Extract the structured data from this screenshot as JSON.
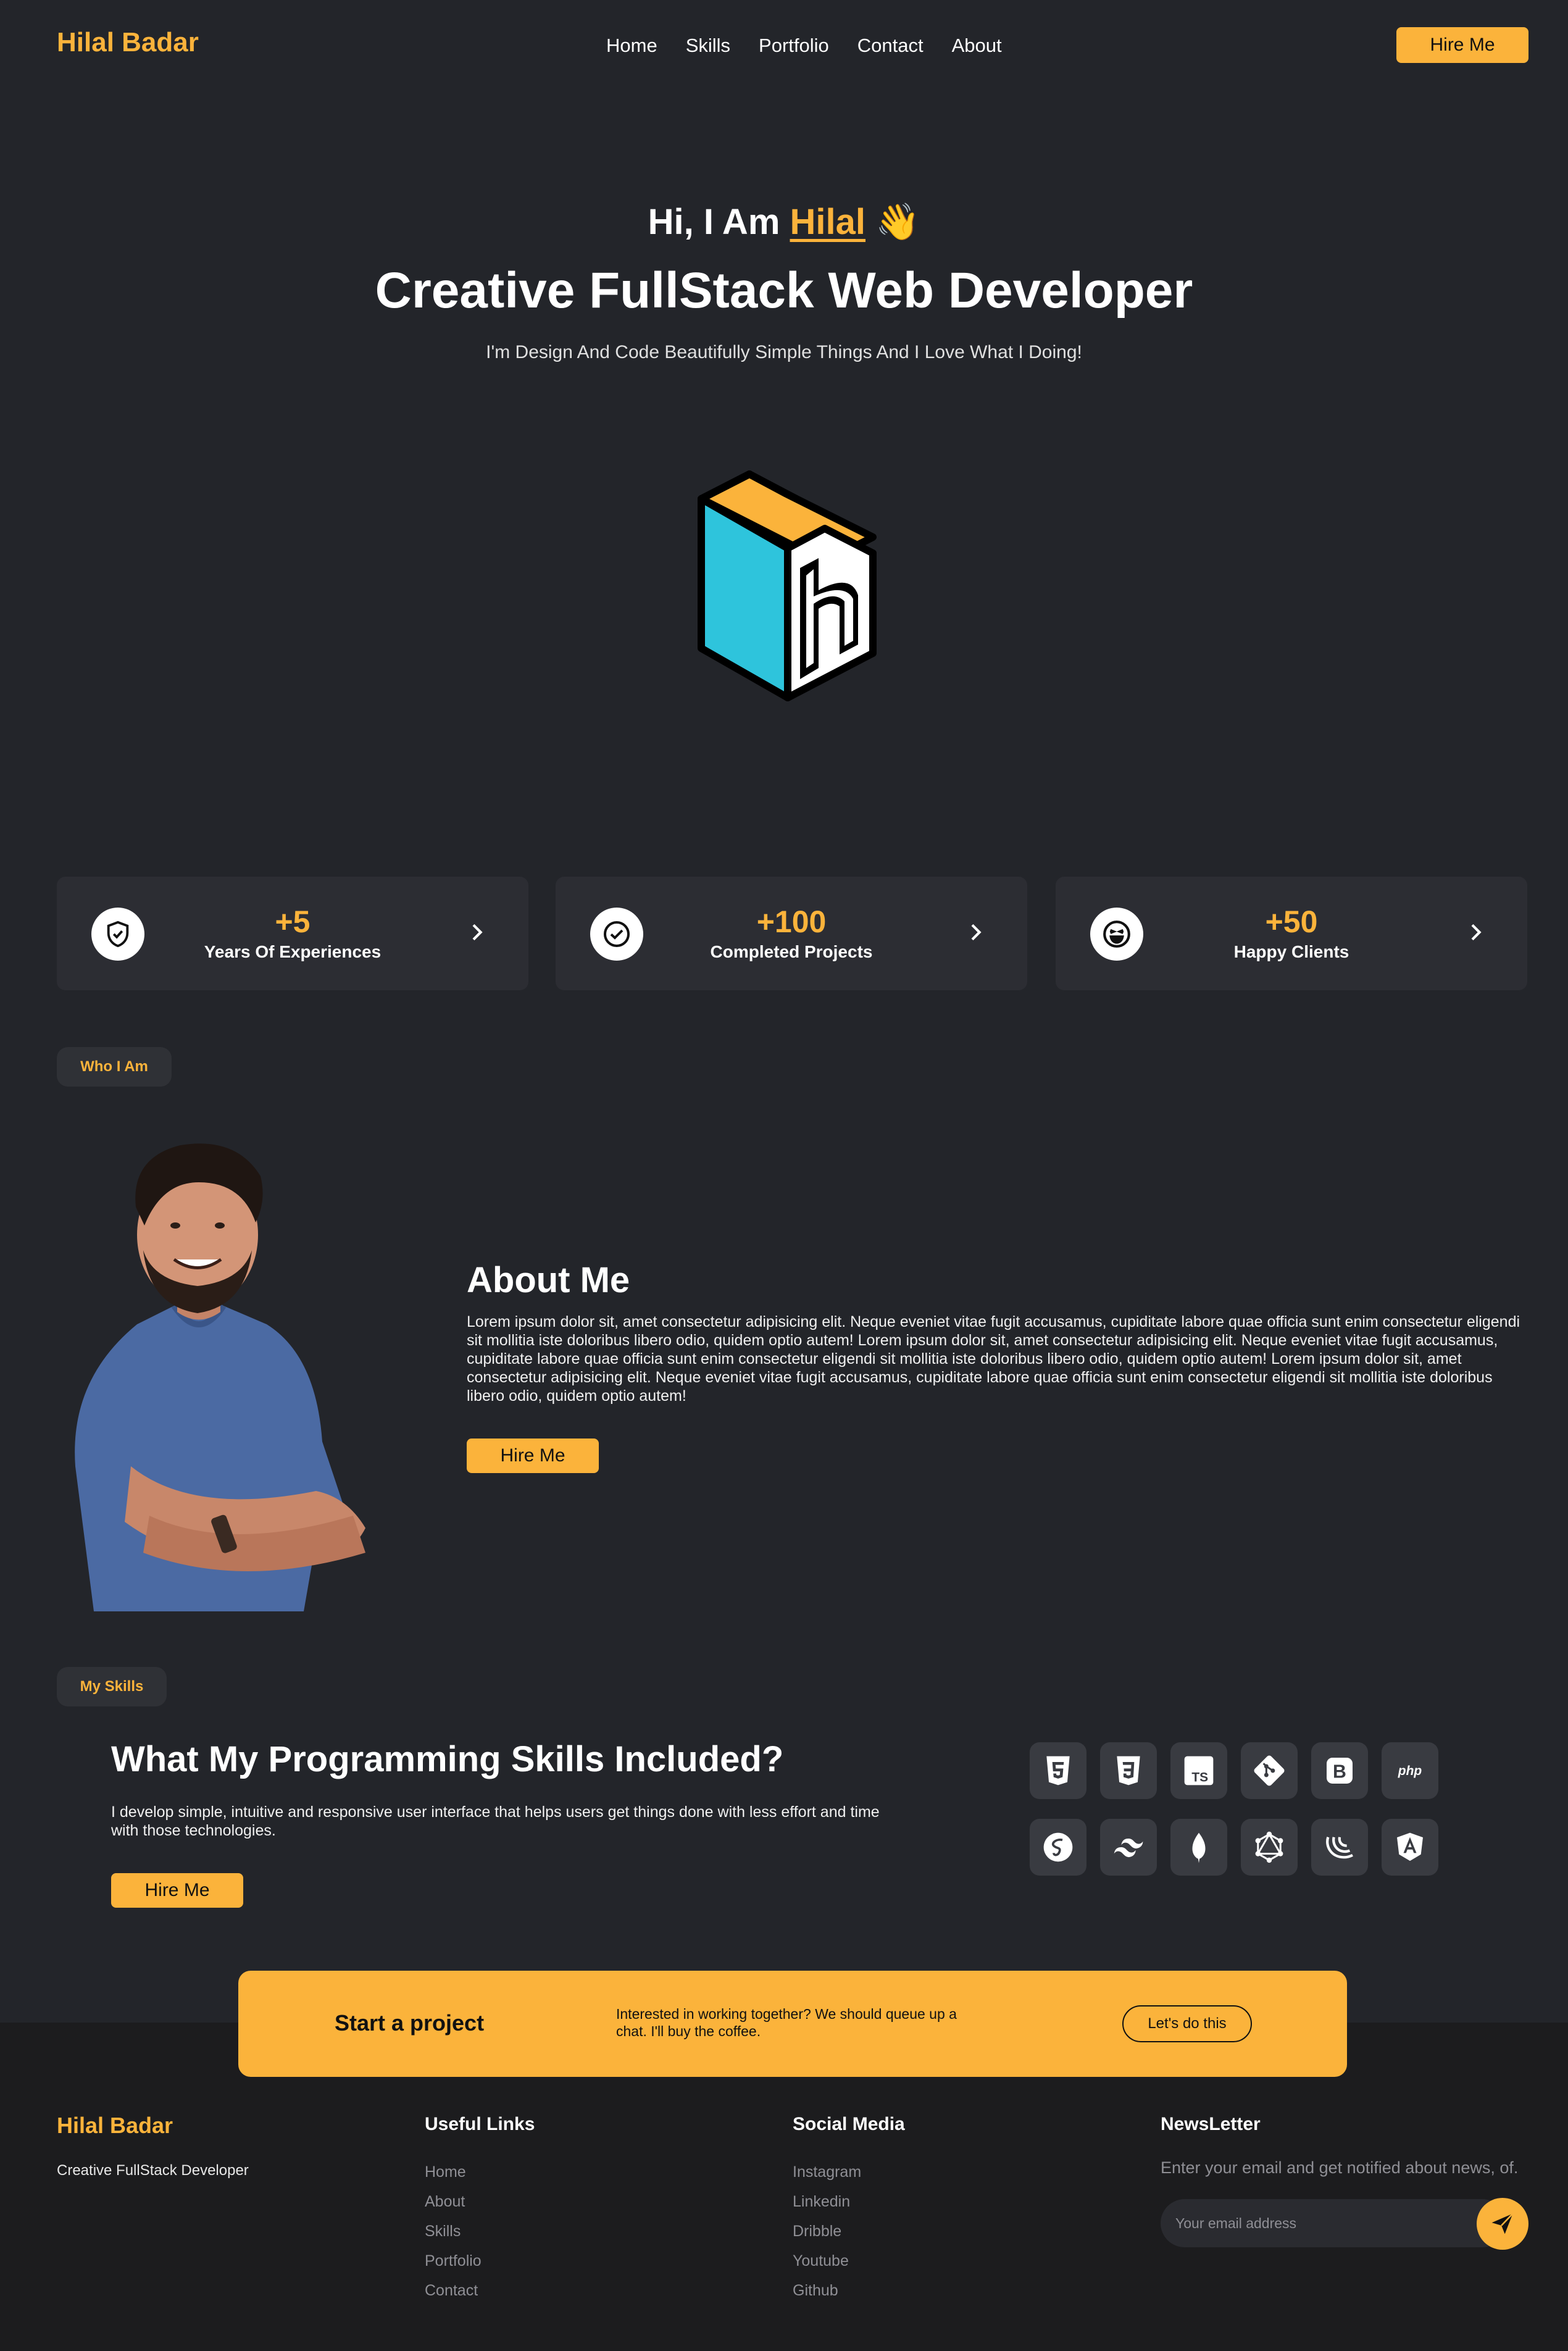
{
  "nav": {
    "brand": "Hilal Badar",
    "links": [
      "Home",
      "Skills",
      "Portfolio",
      "Contact",
      "About"
    ],
    "hire_label": "Hire Me"
  },
  "hero": {
    "greeting": "Hi, I Am ",
    "name": "Hilal",
    "wave": "👋",
    "title": "Creative FullStack Web Developer",
    "subtitle": "I'm Design And Code Beautifully Simple Things And I Love What I Doing!"
  },
  "stats": [
    {
      "value": "+5",
      "label": "Years Of Experiences",
      "icon": "shield-check-icon"
    },
    {
      "value": "+100",
      "label": "Completed Projects",
      "icon": "check-circle-icon"
    },
    {
      "value": "+50",
      "label": "Happy Clients",
      "icon": "laughing-face-icon"
    }
  ],
  "about": {
    "tag": "Who I Am",
    "title": "About Me",
    "text": "Lorem ipsum dolor sit, amet consectetur adipisicing elit. Neque eveniet vitae fugit accusamus, cupiditate labore quae officia sunt enim consectetur eligendi sit mollitia iste doloribus libero odio, quidem optio autem! Lorem ipsum dolor sit, amet consectetur adipisicing elit. Neque eveniet vitae fugit accusamus, cupiditate labore quae officia sunt enim consectetur eligendi sit mollitia iste doloribus libero odio, quidem optio autem! Lorem ipsum dolor sit, amet consectetur adipisicing elit. Neque eveniet vitae fugit accusamus, cupiditate labore quae officia sunt enim consectetur eligendi sit mollitia iste doloribus libero odio, quidem optio autem!",
    "button": "Hire Me"
  },
  "skills": {
    "tag": "My Skills",
    "title": "What My Programming Skills Included?",
    "text": "I develop simple, intuitive and responsive user interface that helps users get things done with less effort and time with those technologies.",
    "button": "Hire Me",
    "icons": [
      "html5-icon",
      "css3-icon",
      "typescript-icon",
      "git-icon",
      "bootstrap-icon",
      "php-icon",
      "sass-icon",
      "tailwind-icon",
      "mongodb-icon",
      "graphql-icon",
      "jquery-icon",
      "angular-icon"
    ],
    "labels": {
      "ts": "TS",
      "b": "B",
      "php": "php"
    }
  },
  "cta": {
    "title": "Start a project",
    "text": "Interested in working together? We should queue up a chat. I'll buy the coffee.",
    "button": "Let's do this"
  },
  "footer": {
    "brand": "Hilal Badar",
    "tagline": "Creative FullStack Developer",
    "useful_title": "Useful Links",
    "useful_links": [
      "Home",
      "About",
      "Skills",
      "Portfolio",
      "Contact"
    ],
    "social_title": "Social Media",
    "social_links": [
      "Instagram",
      "Linkedin",
      "Dribble",
      "Youtube",
      "Github"
    ],
    "news_title": "NewsLetter",
    "news_text": "Enter your email and get notified about news, of.",
    "email_placeholder": "Your email address"
  },
  "colors": {
    "accent": "#fbb33b",
    "background": "#23252a",
    "card": "#2c2d33",
    "footer": "#1c1c1e"
  }
}
